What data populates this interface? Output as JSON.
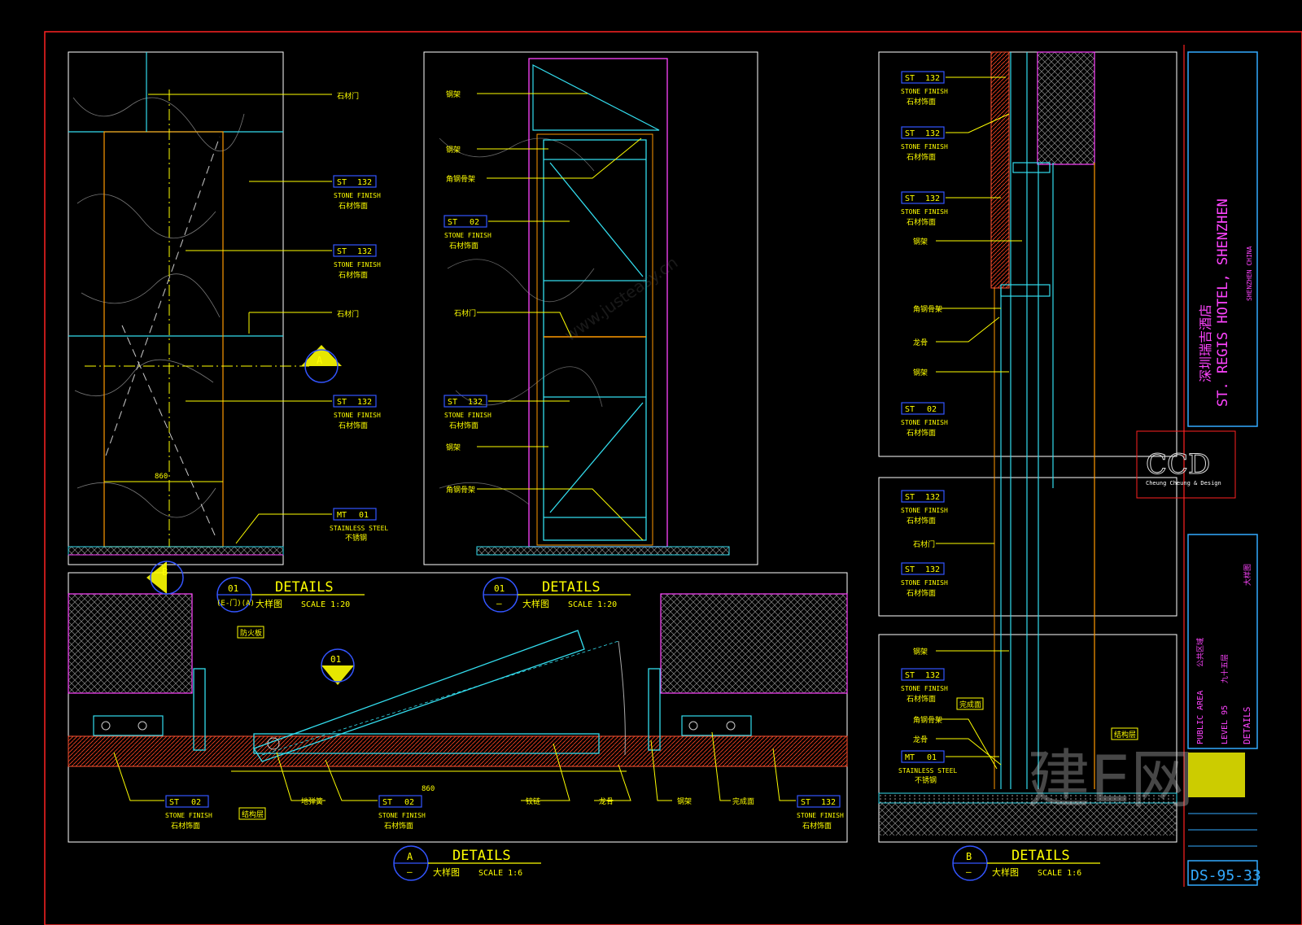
{
  "sheet": {
    "number": "DS-95-33",
    "project_cn": "深圳瑞吉酒店",
    "project_en": "ST. REGIS HOTEL, SHENZHEN",
    "location": "SHENZHEN CHINA",
    "area": "PUBLIC AREA",
    "area_cn": "公共区域",
    "level": "LEVEL 95",
    "level_cn": "九十五层",
    "drawing_title": "DETAILS",
    "drawing_title_cn": "大样图",
    "company": "CCD",
    "company_sub": "Cheung Cheung & Design"
  },
  "details": [
    {
      "tag": "01",
      "ref": "(E-门)(A)",
      "title": "DETAILS",
      "title_cn": "大样图",
      "scale": "SCALE 1:20"
    },
    {
      "tag": "01",
      "ref": "—",
      "title": "DETAILS",
      "title_cn": "大样图",
      "scale": "SCALE 1:20"
    },
    {
      "tag": "A",
      "ref": "—",
      "title": "DETAILS",
      "title_cn": "大样图",
      "scale": "SCALE 1:6"
    },
    {
      "tag": "B",
      "ref": "—",
      "title": "DETAILS",
      "title_cn": "大样图",
      "scale": "SCALE 1:6"
    }
  ],
  "section_markers": {
    "a": "A",
    "b": "B",
    "d01": "01"
  },
  "material_tags": {
    "st132": {
      "code": "ST",
      "num": "132",
      "en": "STONE FINISH",
      "cn": "石材饰面"
    },
    "st02": {
      "code": "ST",
      "num": "02",
      "en": "STONE FINISH",
      "cn": "石材饰面"
    },
    "mt01": {
      "code": "MT",
      "num": "01",
      "en": "STAINLESS STEEL",
      "cn": "不锈钢"
    }
  },
  "dimension": "860",
  "labels": {
    "l1": "石材门",
    "l2": "石材饰面",
    "l3": "钢架",
    "l4": "角钢骨架",
    "l5": "石材门",
    "l6": "铰链",
    "l7": "地弹簧",
    "l8": "防火板",
    "l9": "龙骨",
    "l10": "结构层",
    "l11": "完成面"
  },
  "watermark": "建E网",
  "watermark_url": "www.justeasy.cn"
}
